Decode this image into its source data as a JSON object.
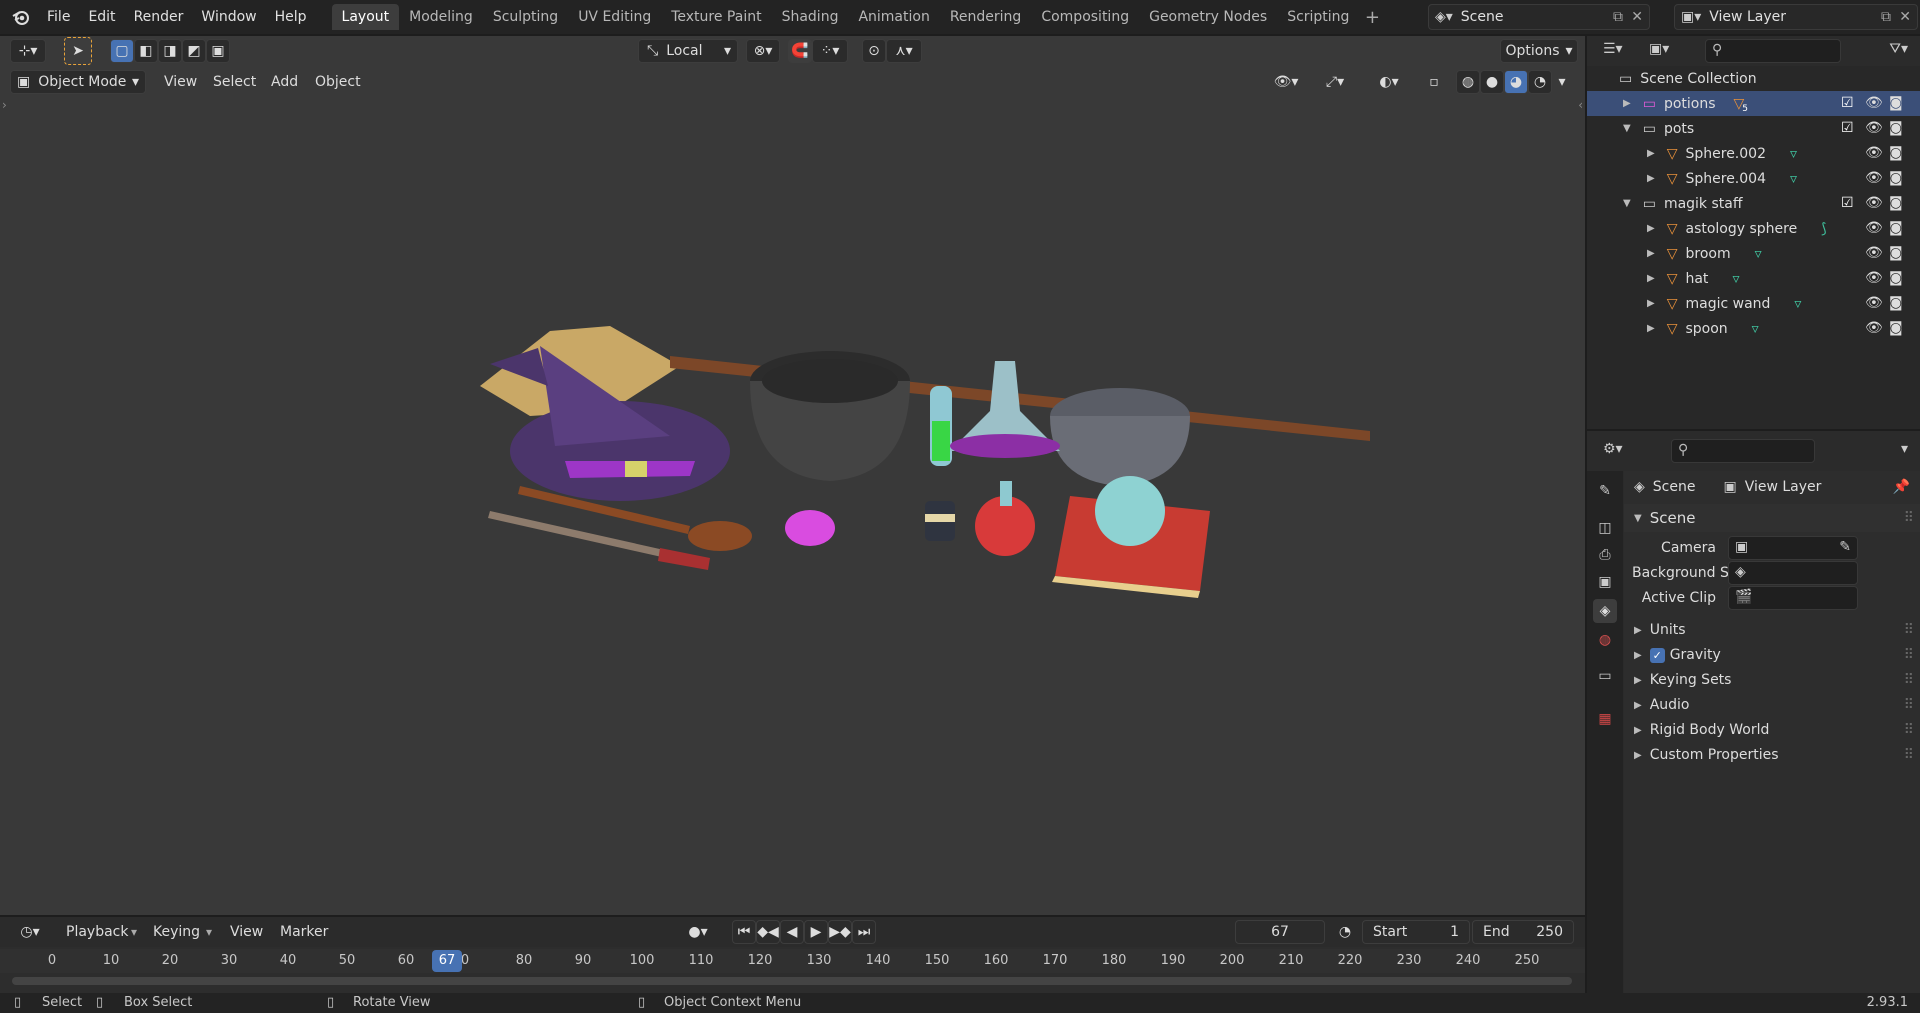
{
  "topbar": {
    "menus": [
      "File",
      "Edit",
      "Render",
      "Window",
      "Help"
    ],
    "workspaces": [
      "Layout",
      "Modeling",
      "Sculpting",
      "UV Editing",
      "Texture Paint",
      "Shading",
      "Animation",
      "Rendering",
      "Compositing",
      "Geometry Nodes",
      "Scripting"
    ],
    "active_workspace": "Layout",
    "scene": "Scene",
    "view_layer": "View Layer"
  },
  "viewport": {
    "transform_orientation": "Local",
    "options_label": "Options",
    "mode": "Object Mode",
    "menus": [
      "View",
      "Select",
      "Add",
      "Object"
    ]
  },
  "timeline": {
    "menus": [
      "Playback",
      "Keying",
      "View",
      "Marker"
    ],
    "current_frame": "67",
    "start_label": "Start",
    "start": "1",
    "end_label": "End",
    "end": "250",
    "ticks": [
      "0",
      "10",
      "20",
      "30",
      "40",
      "50",
      "60",
      "0",
      "80",
      "90",
      "100",
      "110",
      "120",
      "130",
      "140",
      "150",
      "160",
      "170",
      "180",
      "190",
      "200",
      "210",
      "220",
      "230",
      "240",
      "250"
    ],
    "playhead_label": "67"
  },
  "statusbar": {
    "select": "Select",
    "box_select": "Box Select",
    "rotate_view": "Rotate View",
    "context_menu": "Object Context Menu",
    "version": "2.93.1"
  },
  "outliner": {
    "root": "Scene Collection",
    "rows": [
      {
        "name": "potions",
        "badge": "5"
      },
      {
        "name": "pots"
      },
      {
        "name": "Sphere.002"
      },
      {
        "name": "Sphere.004"
      },
      {
        "name": "magik staff"
      },
      {
        "name": "astology sphere"
      },
      {
        "name": "broom"
      },
      {
        "name": "hat"
      },
      {
        "name": "magic wand"
      },
      {
        "name": "spoon"
      }
    ]
  },
  "properties": {
    "breadcrumb_scene": "Scene",
    "breadcrumb_layer": "View Layer",
    "panel_title": "Scene",
    "camera_label": "Camera",
    "bg_scene_label": "Background Sc...",
    "active_clip_label": "Active Clip",
    "sections": [
      "Units",
      "Gravity",
      "Keying Sets",
      "Audio",
      "Rigid Body World",
      "Custom Properties"
    ]
  },
  "colors": {
    "accent": "#4772b3",
    "selection": "#3b4f78",
    "object_orange": "#e8913a",
    "mesh_green": "#3fc29e"
  }
}
